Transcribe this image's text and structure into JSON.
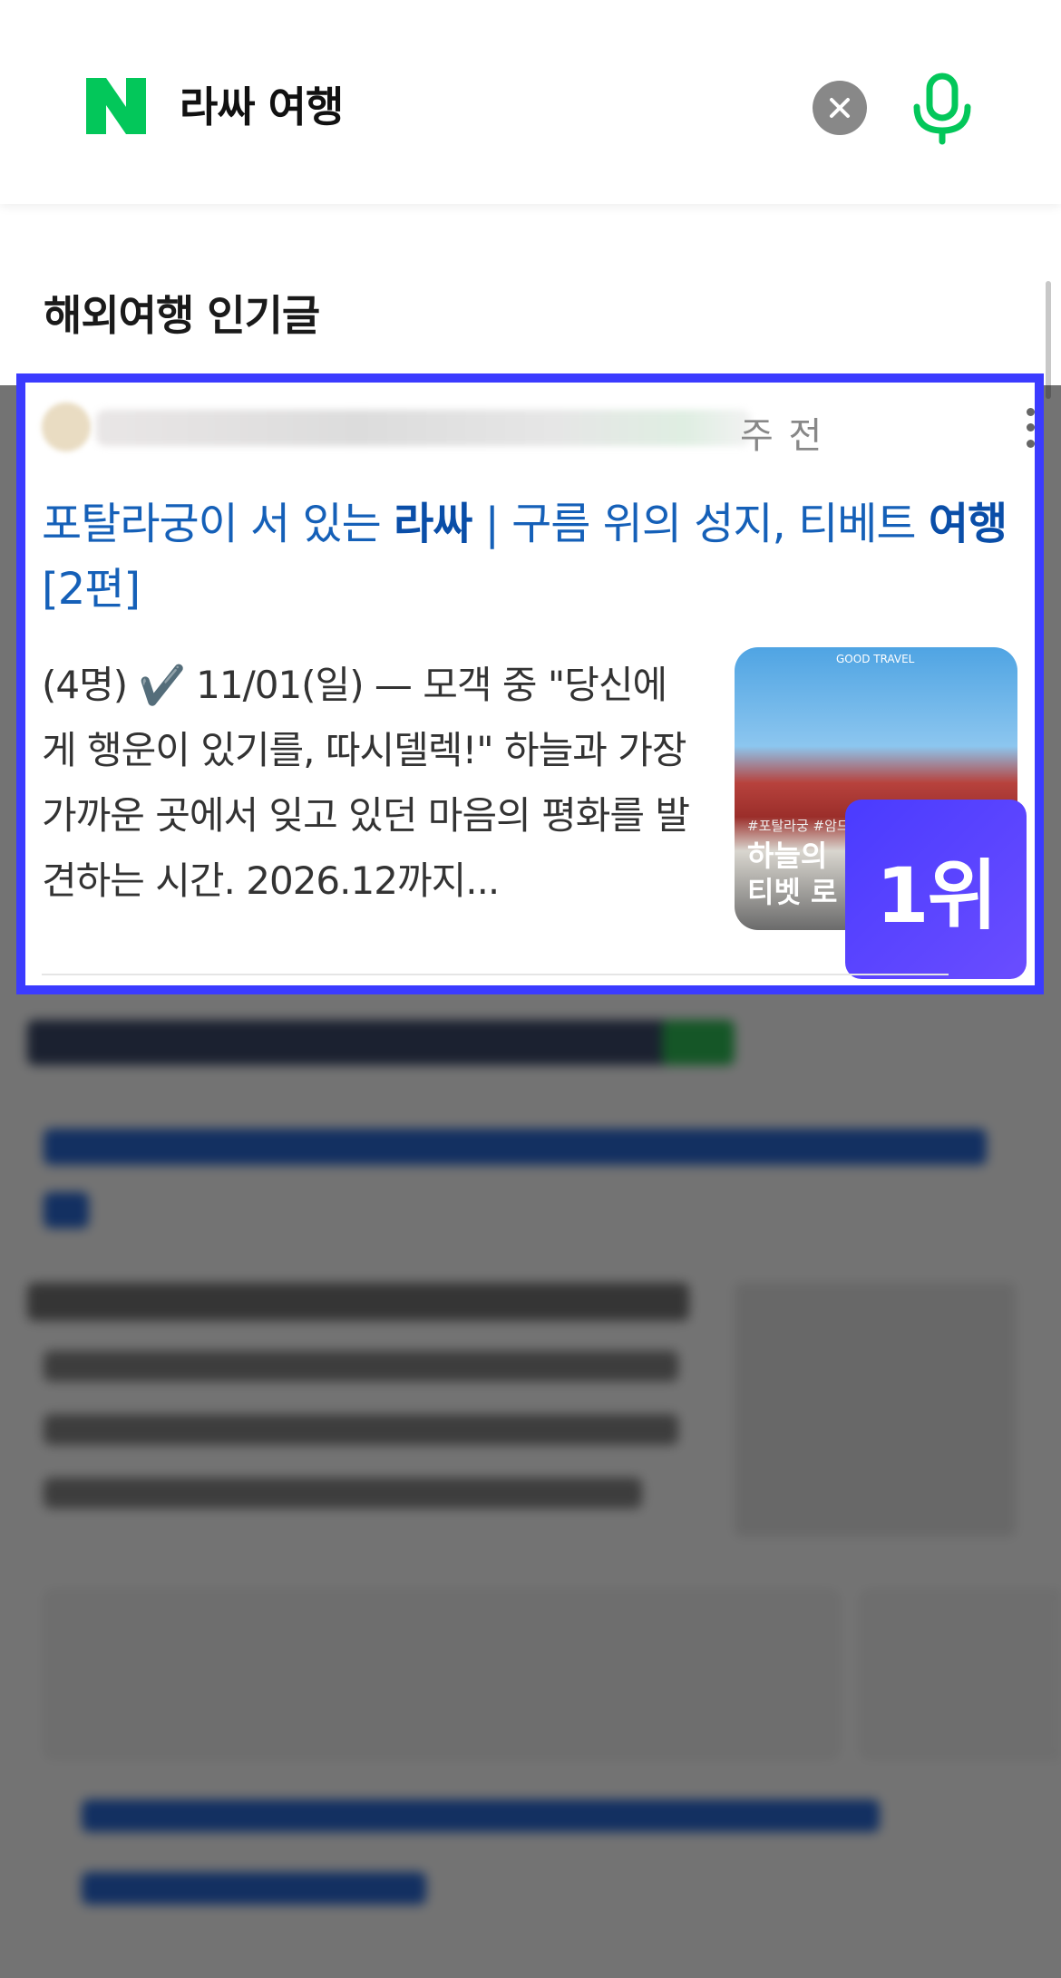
{
  "search": {
    "logo_letter": "N",
    "query": "라싸 여행"
  },
  "section": {
    "title": "해외여행 인기글"
  },
  "featured_post": {
    "time_ago": "주 전",
    "title_parts": [
      {
        "text": "포탈라궁이 서 있는 ",
        "bold": false
      },
      {
        "text": "라싸",
        "bold": true
      },
      {
        "text": " | 구름 위의 성지, 티베트 ",
        "bold": false
      },
      {
        "text": "여행",
        "bold": true
      },
      {
        "text": " [2편]",
        "bold": false
      }
    ],
    "snippet": "(4명) ✔️ 11/01(일) — 모객 중 \"당신에게 행운이 있기를, 따시델렉!\" 하늘과 가장 가까운 곳에서 잊고 있던 마음의 평화를 발견하는 시간. 2026.12까지...",
    "thumbnail": {
      "brand": "GOOD TRAVEL",
      "tags": "#포탈라궁 #암드",
      "caption_line1": "하늘의",
      "caption_line2": "티벳 로"
    },
    "rank_badge": "1위"
  },
  "colors": {
    "naver_green": "#03c75a",
    "highlight_border": "#3b3bff",
    "link_blue": "#1560b8"
  }
}
